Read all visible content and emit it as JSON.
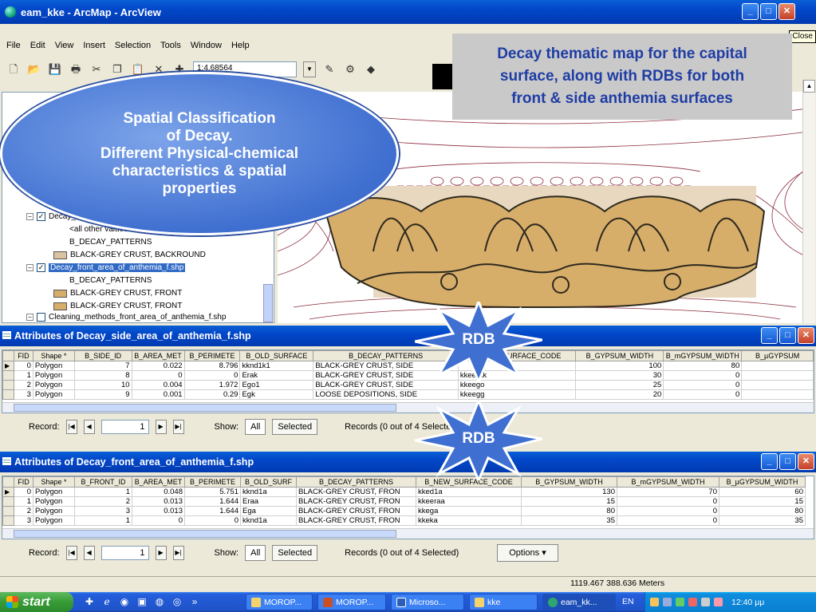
{
  "window": {
    "title": "eam_kke - ArcMap - ArcView",
    "close_tooltip": "Close"
  },
  "menu": [
    "File",
    "Edit",
    "View",
    "Insert",
    "Selection",
    "Tools",
    "Window",
    "Help"
  ],
  "toolbar": {
    "scale": "1:4.68564"
  },
  "toc": {
    "layers": [
      {
        "label": "Decay_..."
      },
      {
        "label": "<all other values>"
      },
      {
        "label": "B_DECAY_PATTERNS"
      },
      {
        "label": "BLACK-GREY CRUST, BACKROUND"
      },
      {
        "label": "Decay_front_area_of_anthemia_f.shp"
      },
      {
        "label": "B_DECAY_PATTERNS"
      },
      {
        "label": "BLACK-GREY CRUST, FRONT"
      },
      {
        "label": "BLACK-GREY CRUST, FRONT"
      },
      {
        "label": "Cleaning_methods_front_area_of_anthemia_f.shp"
      }
    ],
    "colors": {
      "beige": "#d8c4a0",
      "tan": "#d7ad6a"
    }
  },
  "callouts": {
    "oval": "Spatial Classification\nof Decay.\nDifferent Physical-chemical\ncharacteristics & spatial\nproperties",
    "box": "Decay thematic map for the capital\nsurface, along with RDBs for both\nfront & side anthemia surfaces",
    "rdb1": "RDB",
    "rdb2": "RDB"
  },
  "side_table": {
    "title": "Attributes of Decay_side_area_of_anthemia_f.shp",
    "columns": [
      "FID",
      "Shape *",
      "B_SIDE_ID",
      "B_AREA_MET",
      "B_PERIMETE",
      "B_OLD_SURFACE",
      "B_DECAY_PATTERNS",
      "B_NEW_SURFACE_CODE",
      "B_GYPSUM_WIDTH",
      "B_mGYPSUM_WIDTH",
      "B_µGYPSUM"
    ],
    "rows": [
      [
        "0",
        "Polygon",
        "7",
        "0.022",
        "8.796",
        "kknd1k1",
        "BLACK-GREY CRUST, SIDE",
        "",
        "100",
        "80",
        ""
      ],
      [
        "1",
        "Polygon",
        "8",
        "0",
        "0",
        "Erak",
        "BLACK-GREY CRUST, SIDE",
        "kkeerak",
        "30",
        "0",
        ""
      ],
      [
        "2",
        "Polygon",
        "10",
        "0.004",
        "1.972",
        "Ego1",
        "BLACK-GREY CRUST, SIDE",
        "kkeego",
        "25",
        "0",
        ""
      ],
      [
        "3",
        "Polygon",
        "9",
        "0.001",
        "0.29",
        "Egk",
        "LOOSE DEPOSITIONS, SIDE",
        "kkeegg",
        "20",
        "0",
        ""
      ]
    ],
    "nav": {
      "record_label": "Record:",
      "record_value": "1",
      "show_label": "Show:",
      "all_label": "All",
      "selected_label": "Selected",
      "records_info": "Records (0 out of 4 Selected)"
    }
  },
  "front_table": {
    "title": "Attributes of Decay_front_area_of_anthemia_f.shp",
    "columns": [
      "FID",
      "Shape *",
      "B_FRONT_ID",
      "B_AREA_MET",
      "B_PERIMETE",
      "B_OLD_SURF",
      "B_DECAY_PATTERNS",
      "B_NEW_SURFACE_CODE",
      "B_GYPSUM_WIDTH",
      "B_mGYPSUM_WIDTH",
      "B_µGYPSUM_WIDTH"
    ],
    "rows": [
      [
        "0",
        "Polygon",
        "1",
        "0.048",
        "5.751",
        "kknd1a",
        "BLACK-GREY CRUST, FRON",
        "kked1a",
        "130",
        "70",
        "60"
      ],
      [
        "1",
        "Polygon",
        "2",
        "0.013",
        "1.644",
        "Eraa",
        "BLACK-GREY CRUST, FRON",
        "kkeeraa",
        "15",
        "0",
        "15"
      ],
      [
        "2",
        "Polygon",
        "3",
        "0.013",
        "1.644",
        "Ega",
        "BLACK-GREY CRUST, FRON",
        "kkega",
        "80",
        "0",
        "80"
      ],
      [
        "3",
        "Polygon",
        "1",
        "0",
        "0",
        "kknd1a",
        "BLACK-GREY CRUST, FRON",
        "kkeka",
        "35",
        "0",
        "35"
      ]
    ],
    "nav": {
      "record_label": "Record:",
      "record_value": "1",
      "show_label": "Show:",
      "all_label": "All",
      "selected_label": "Selected",
      "records_info": "Records (0 out of 4 Selected)",
      "options_label": "Options"
    }
  },
  "status": {
    "coords": "1119.467  388.636 Meters"
  },
  "taskbar": {
    "start": "start",
    "tasks": [
      "MOROP...",
      "MOROP...",
      "Microso...",
      "kke",
      "eam_kk..."
    ],
    "lang": "EN",
    "clock": "12:40 μμ"
  }
}
